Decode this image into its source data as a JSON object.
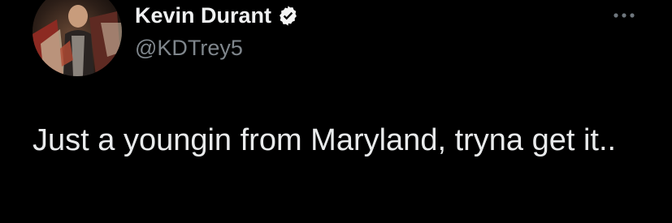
{
  "tweet": {
    "author": {
      "name": "Kevin Durant",
      "handle": "@KDTrey5",
      "verified": true,
      "avatar_icon": "profile-photo"
    },
    "text": "Just a youngin from Maryland, tryna get it..",
    "more_icon": "ellipsis-icon"
  },
  "colors": {
    "background": "#000000",
    "name": "#f0f1f2",
    "handle": "#7f868c",
    "body_text": "#e9ebec",
    "verified_badge": "#f5f5f5",
    "more_icon": "#6e767d"
  }
}
